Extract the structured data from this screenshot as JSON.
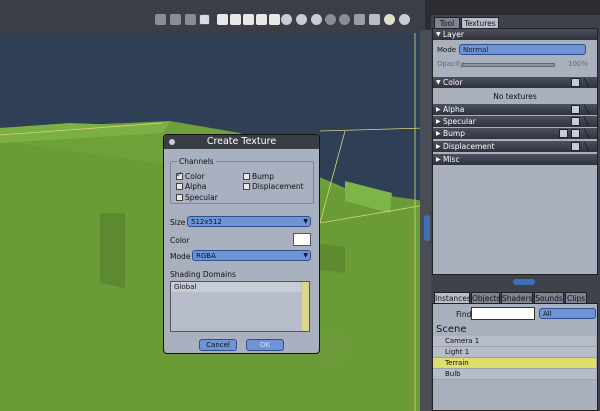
{
  "right_panel": {
    "tabs": [
      "Tool",
      "Textures"
    ],
    "sections": {
      "layer": "Layer",
      "color": "Color",
      "alpha": "Alpha",
      "specular": "Specular",
      "bump": "Bump",
      "displacement": "Displacement",
      "misc": "Misc"
    },
    "mode_label": "Mode",
    "mode_value": "Normal",
    "opacity_label": "Opacity",
    "opacity_value": "100%",
    "no_textures": "No textures"
  },
  "instances_panel": {
    "tabs": [
      "Instances",
      "Objects",
      "Shaders",
      "Sounds",
      "Clips"
    ],
    "find_label": "Find:",
    "find_value": "",
    "filter_value": "All",
    "scene_label": "Scene",
    "items": [
      "Camera 1",
      "Light 1",
      "Terrain",
      "Bulb"
    ],
    "selected_item": "Terrain"
  },
  "dialog": {
    "title": "Create Texture",
    "channels_label": "Channels",
    "channels": {
      "color": {
        "label": "Color",
        "checked": true
      },
      "bump": {
        "label": "Bump",
        "checked": false
      },
      "alpha": {
        "label": "Alpha",
        "checked": false
      },
      "displacement": {
        "label": "Displacement",
        "checked": false
      },
      "specular": {
        "label": "Specular",
        "checked": false
      }
    },
    "size_label": "Size",
    "size_value": "512x512",
    "color_label": "Color",
    "color_value": "#ffffff",
    "mode_label": "Mode",
    "mode_value": "RGBA",
    "domains_label": "Shading Domains",
    "domains": [
      "Global"
    ],
    "cancel_label": "Cancel",
    "ok_label": "OK"
  }
}
